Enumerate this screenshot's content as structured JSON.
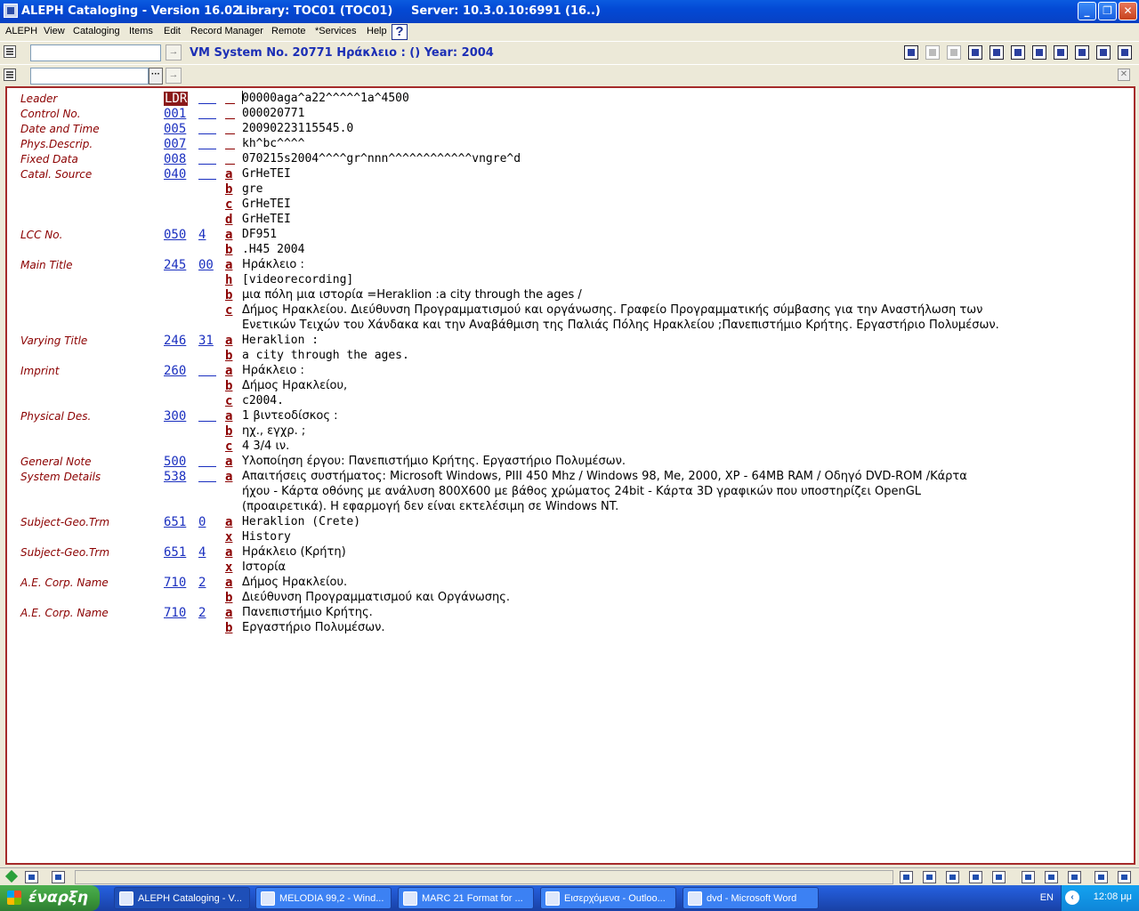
{
  "window": {
    "app_title": "ALEPH Cataloging - Version 16.02",
    "library": "Library:  TOC01 (TOC01)",
    "server": "Server:  10.3.0.10:6991 (16..)",
    "buttons": {
      "minimize": "_",
      "maximize": "❐",
      "close": "✕"
    }
  },
  "menu": [
    "ALEPH",
    "View",
    "Cataloging",
    "Items",
    "Edit",
    "Record Manager",
    "Remote",
    "*Services",
    "Help"
  ],
  "help_icon": "?",
  "toolbar": {
    "record_title": "VM System No. 20771 Ηράκλειο : () Year: 2004",
    "go_label": "→",
    "browse_label": "···"
  },
  "record": [
    {
      "label": "Leader",
      "tag": "LDR",
      "ind": "",
      "sub": "",
      "value": "00000aga^a22^^^^^1a^4500"
    },
    {
      "label": "Control No.",
      "tag": "001",
      "ind": "",
      "sub": "",
      "value": "000020771"
    },
    {
      "label": "Date and Time",
      "tag": "005",
      "ind": "",
      "sub": "",
      "value": "20090223115545.0"
    },
    {
      "label": "Phys.Descrip.",
      "tag": "007",
      "ind": "",
      "sub": "",
      "value": "kh^bc^^^^"
    },
    {
      "label": "Fixed Data",
      "tag": "008",
      "ind": "",
      "sub": "",
      "value": "070215s2004^^^^gr^nnn^^^^^^^^^^^^vngre^d"
    },
    {
      "label": "Catal. Source",
      "tag": "040",
      "ind": "",
      "sub": "a",
      "value": "GrHeTEI"
    },
    {
      "label": "",
      "tag": "",
      "ind": null,
      "sub": "b",
      "value": "gre"
    },
    {
      "label": "",
      "tag": "",
      "ind": null,
      "sub": "c",
      "value": "GrHeTEI"
    },
    {
      "label": "",
      "tag": "",
      "ind": null,
      "sub": "d",
      "value": "GrHeTEI"
    },
    {
      "label": "LCC No.",
      "tag": "050",
      "ind": " 4",
      "sub": "a",
      "value": "DF951"
    },
    {
      "label": "",
      "tag": "",
      "ind": null,
      "sub": "b",
      "value": ".H45 2004"
    },
    {
      "label": "Main Title",
      "tag": "245",
      "ind": "00",
      "sub": "a",
      "value": "Ηράκλειο :"
    },
    {
      "label": "",
      "tag": "",
      "ind": null,
      "sub": "h",
      "value": "[videorecording]"
    },
    {
      "label": "",
      "tag": "",
      "ind": null,
      "sub": "b",
      "value": "μια πόλη μια ιστορία =Heraklion :a city through the ages /"
    },
    {
      "label": "",
      "tag": "",
      "ind": null,
      "sub": "c",
      "value": "Δήμος Ηρακλείου. Διεύθυνση Προγραμματισμού και οργάνωσης. Γραφείο Προγραμματικής σύμβασης για την Αναστήλωση των"
    },
    {
      "label": "",
      "tag": "",
      "ind": null,
      "sub": null,
      "value": "Ενετικών Τειχών του Χάνδακα και την Αναβάθμιση της Παλιάς Πόλης Ηρακλείου ;Πανεπιστήμιο Κρήτης. Εργαστήριο Πολυμέσων."
    },
    {
      "label": "Varying Title",
      "tag": "246",
      "ind": "31",
      "sub": "a",
      "value": "Heraklion :"
    },
    {
      "label": "",
      "tag": "",
      "ind": null,
      "sub": "b",
      "value": "a city through the ages."
    },
    {
      "label": "Imprint",
      "tag": "260",
      "ind": "",
      "sub": "a",
      "value": "Ηράκλειο :"
    },
    {
      "label": "",
      "tag": "",
      "ind": null,
      "sub": "b",
      "value": "Δήμος Ηρακλείου,"
    },
    {
      "label": "",
      "tag": "",
      "ind": null,
      "sub": "c",
      "value": "c2004."
    },
    {
      "label": "Physical Des.",
      "tag": "300",
      "ind": "",
      "sub": "a",
      "value": "1 βιντεοδίσκος :"
    },
    {
      "label": "",
      "tag": "",
      "ind": null,
      "sub": "b",
      "value": "ηχ., εγχρ. ;"
    },
    {
      "label": "",
      "tag": "",
      "ind": null,
      "sub": "c",
      "value": "4 3/4 ιν."
    },
    {
      "label": "General Note",
      "tag": "500",
      "ind": "",
      "sub": "a",
      "value": "Υλοποίηση έργου: Πανεπιστήμιο Κρήτης. Εργαστήριο Πολυμέσων."
    },
    {
      "label": "System Details",
      "tag": "538",
      "ind": "",
      "sub": "a",
      "value": "Απαιτήσεις συστήματος: Microsoft Windows, PIII 450 Mhz / Windows 98, Me, 2000, XP - 64MB RAM / Οδηγό DVD-ROM /Κάρτα"
    },
    {
      "label": "",
      "tag": "",
      "ind": null,
      "sub": null,
      "value": "ήχου - Κάρτα οθόνης με ανάλυση 800X600 με βάθος χρώματος 24bit - Κάρτα 3D γραφικών που υποστηρίζει OpenGL"
    },
    {
      "label": "",
      "tag": "",
      "ind": null,
      "sub": null,
      "value": "(προαιρετικά). Η εφαρμογή δεν είναι εκτελέσιμη σε Windows NT."
    },
    {
      "label": "Subject-Geo.Trm",
      "tag": "651",
      "ind": " 0",
      "sub": "a",
      "value": "Heraklion (Crete)"
    },
    {
      "label": "",
      "tag": "",
      "ind": null,
      "sub": "x",
      "value": "History"
    },
    {
      "label": "Subject-Geo.Trm",
      "tag": "651",
      "ind": " 4",
      "sub": "a",
      "value": "Ηράκλειο (Κρήτη)"
    },
    {
      "label": "",
      "tag": "",
      "ind": null,
      "sub": "x",
      "value": "Ιστορία"
    },
    {
      "label": "A.E. Corp. Name",
      "tag": "710",
      "ind": "2",
      "sub": "a",
      "value": "Δήμος Ηρακλείου."
    },
    {
      "label": "",
      "tag": "",
      "ind": null,
      "sub": "b",
      "value": "Διεύθυνση Προγραμματισμού και Οργάνωσης."
    },
    {
      "label": "A.E. Corp. Name",
      "tag": "710",
      "ind": "2",
      "sub": "a",
      "value": "Πανεπιστήμιο Κρήτης."
    },
    {
      "label": "",
      "tag": "",
      "ind": null,
      "sub": "b",
      "value": "Εργαστήριο Πολυμέσων."
    }
  ],
  "taskbar": {
    "start_label": "έναρξη",
    "tasks": [
      "ALEPH Cataloging - V...",
      "MELODIA 99,2 - Wind...",
      "MARC 21 Format for ...",
      "Εισερχόμενα - Outloo...",
      "dvd - Microsoft Word"
    ],
    "lang": "EN",
    "clock": "12:08 μμ"
  },
  "colors": {
    "tag_blue": "#1a2fbf",
    "label_red": "#8b0000",
    "title_blue": "#1c2fb5"
  }
}
